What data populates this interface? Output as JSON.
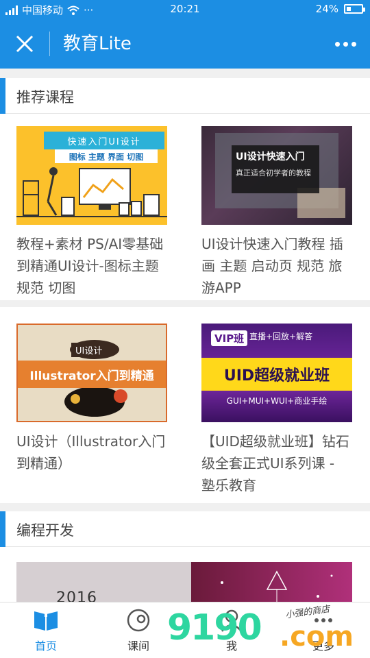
{
  "status": {
    "carrier": "中国移动",
    "time": "20:21",
    "battery": "24%"
  },
  "nav": {
    "title": "教育Lite"
  },
  "sections": [
    {
      "title": "推荐课程",
      "courses": [
        {
          "caption": "教程+素材 PS/AI零基础到精通UI设计-图标主题 规范 切图",
          "thumb": {
            "line1": "快速入门UI设计",
            "line2": "图标 主题 界面 切图"
          }
        },
        {
          "caption": "UI设计快速入门教程 插画 主题 启动页 规范 旅游APP",
          "thumb": {
            "line1": "UI设计快速入门",
            "line2": "真正适合初学者的教程"
          }
        },
        {
          "caption": "UI设计（Illustrator入门到精通）",
          "thumb": {
            "line1": "UI设计",
            "line2": "Illustrator入门到精通"
          }
        },
        {
          "caption": "【UID超级就业班】钻石级全套正式UI系列课 - 塾乐教育",
          "thumb": {
            "vip": "VIP班",
            "sub": "直播+回放+解答",
            "big": "UID超级就业班",
            "small": "GUI+MUI+WUI+商业手绘"
          }
        }
      ]
    },
    {
      "title": "编程开发",
      "courses": [
        {
          "thumb": {
            "year": "2016"
          }
        }
      ]
    }
  ],
  "tabs": [
    {
      "label": "首页",
      "icon": "book-icon",
      "active": true
    },
    {
      "label": "课间",
      "icon": "clock-icon",
      "active": false
    },
    {
      "label": "我",
      "icon": "user-icon",
      "active": false
    },
    {
      "label": "更多",
      "icon": "more-icon",
      "active": false
    }
  ],
  "watermark": {
    "logo": "9190",
    "com": ".com",
    "cn": "小强的商店"
  },
  "colors": {
    "primary": "#1c8ee3",
    "background": "#f0f0f0"
  }
}
